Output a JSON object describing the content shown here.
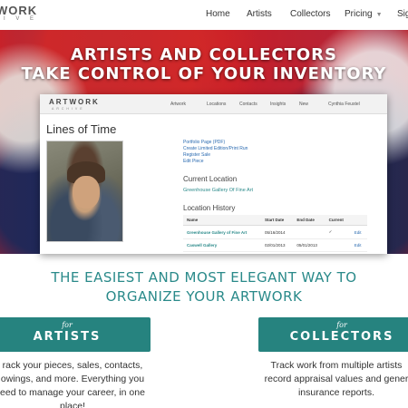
{
  "topnav": {
    "logo_main": "WORK",
    "logo_sub": "I V E",
    "items": [
      {
        "label": "Home"
      },
      {
        "label": "Artists"
      },
      {
        "label": "Collectors"
      },
      {
        "label": "Pricing"
      },
      {
        "label": "Sig"
      }
    ]
  },
  "hero": {
    "title_line1": "ARTISTS AND COLLECTORS",
    "title_line2": "TAKE CONTROL OF YOUR INVENTORY"
  },
  "app": {
    "logo": "ARTWORK",
    "logo_sub": "ARCHIVE",
    "nav": [
      "Artwork",
      "Locations",
      "Contacts",
      "Insights",
      "New",
      "Cynthia Feustel"
    ],
    "piece_title": "Lines of Time",
    "links": [
      "Portfolio Page (PDF)",
      "Create Limited Edition/Print Run",
      "Register Sale",
      "Edit Piece"
    ],
    "current_location_title": "Current Location",
    "current_location": "Greenhouse Gallery Of Fine Art",
    "history_title": "Location History",
    "table": {
      "headers": [
        "Name",
        "Start Date",
        "End Date",
        "Current",
        ""
      ],
      "rows": [
        {
          "name": "Greenhouse Gallery of Fine Art",
          "start": "05/16/2014",
          "end": "",
          "current": "✓",
          "action": "Edit"
        },
        {
          "name": "Caswell Gallery",
          "start": "02/01/2013",
          "end": "05/01/2013",
          "current": "",
          "action": "Edit"
        }
      ]
    }
  },
  "tagline": {
    "line1": "THE EASIEST AND MOST ELEGANT WAY TO",
    "line2": "ORGANIZE YOUR ARTWORK"
  },
  "cards": {
    "artists": {
      "for": "for",
      "label": "ARTISTS",
      "text1": "rack your pieces, sales, contacts,",
      "text2": "owings, and more. Everything you",
      "text3": "eed to manage your career, in one",
      "text4": "place!"
    },
    "collectors": {
      "for": "for",
      "label": "COLLECTORS",
      "text1": "Track work from multiple artists",
      "text2": "record appraisal values and gener",
      "text3": "insurance reports."
    }
  },
  "colors": {
    "teal": "#26837f",
    "link": "#2a6ab0",
    "hero_red": "#c4202a",
    "hero_blue": "#2a3a7a"
  }
}
